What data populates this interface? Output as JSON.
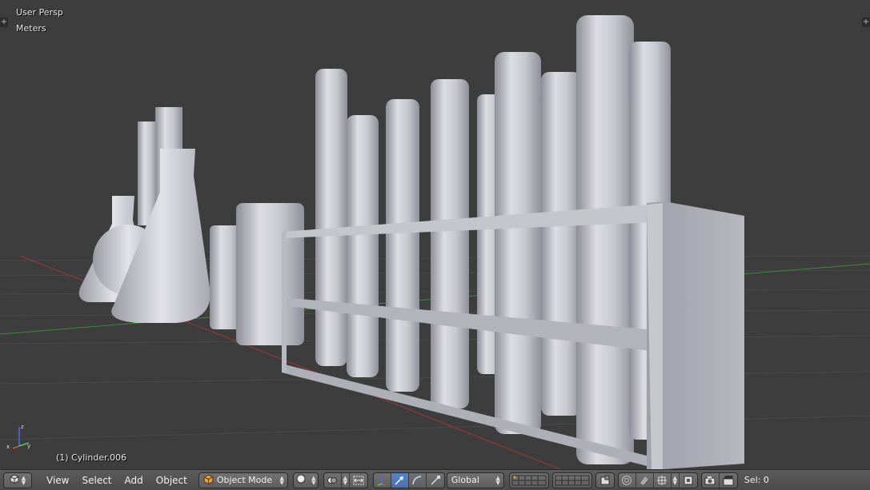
{
  "viewport": {
    "perspective_label": "User Persp",
    "units_label": "Meters",
    "active_object_label": "(1) Cylinder.006",
    "corner_widget_glyph": "+"
  },
  "axis_gizmo": {
    "x_label": "x",
    "y_label": "y",
    "z_label": "z"
  },
  "header": {
    "editor_type_icon": "3d-view-cube-icon",
    "menus": [
      "View",
      "Select",
      "Add",
      "Object"
    ],
    "mode_dropdown": {
      "icon": "object-mode-cube-icon",
      "value": "Object Mode"
    },
    "shading_icon": "solid-sphere-icon",
    "orientation_dropdown": {
      "value": "Global"
    },
    "selection_status": "Sel: 0"
  },
  "colors": {
    "viewport_bg": "#3d3d3d",
    "grid_line": "#4a4a4a",
    "x_axis": "#a03838",
    "y_axis": "#3a8a3a",
    "mesh_light": "#d6d6dc",
    "mesh_dark": "#8e8e98",
    "rack": "#b2b2ba",
    "active_blue": "#5680c2"
  }
}
